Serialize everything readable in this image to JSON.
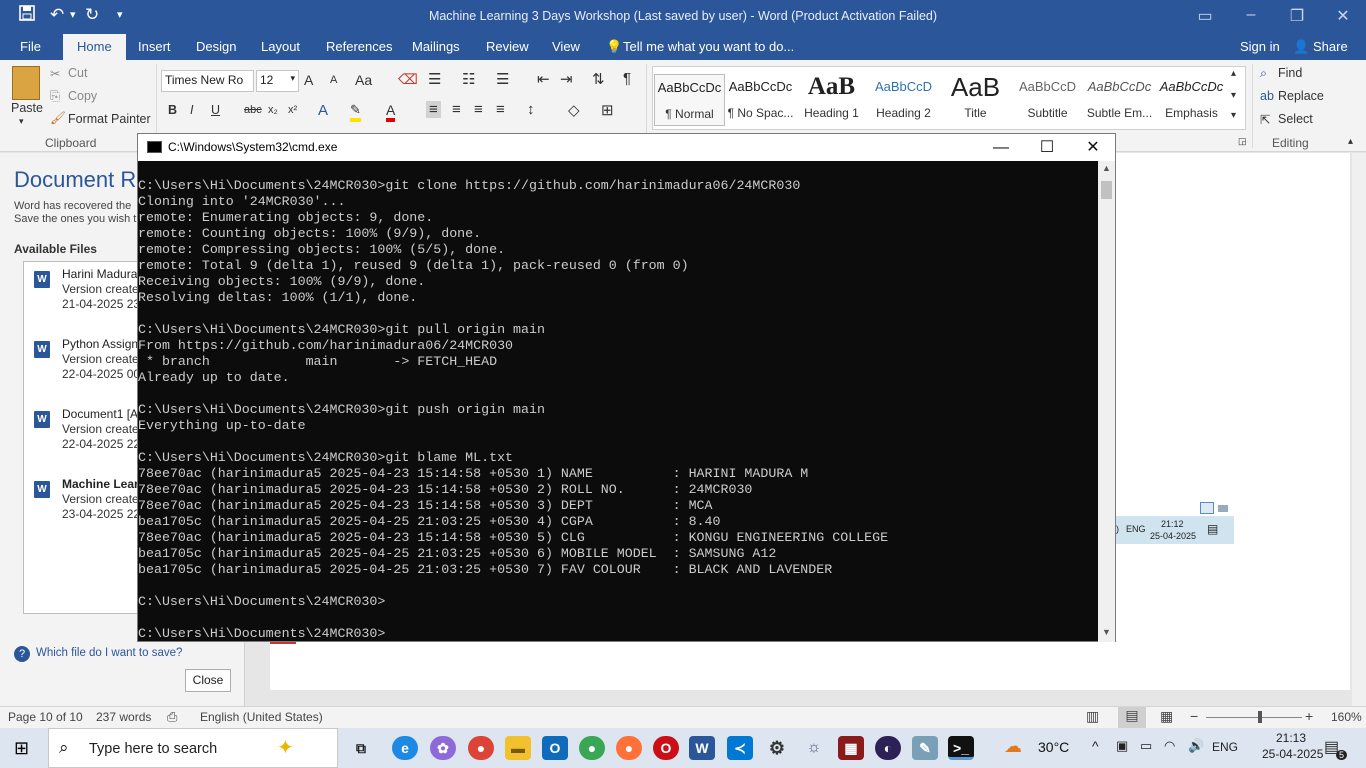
{
  "word": {
    "window_title": "Machine Learning 3 Days Workshop (Last saved by user) - Word (Product Activation Failed)",
    "tabs": [
      "File",
      "Home",
      "Insert",
      "Design",
      "Layout",
      "References",
      "Mailings",
      "Review",
      "View"
    ],
    "tell_me": "Tell me what you want to do...",
    "sign_in": "Sign in",
    "share": "Share",
    "clipboard": {
      "paste": "Paste",
      "cut": "Cut",
      "copy": "Copy",
      "format_painter": "Format Painter",
      "group": "Clipboard"
    },
    "font": {
      "name": "Times New Ro",
      "size": "12"
    },
    "styles": [
      {
        "preview": "AaBbCcDc",
        "name": "¶ Normal"
      },
      {
        "preview": "AaBbCcDc",
        "name": "¶ No Spac..."
      },
      {
        "preview": "AaB",
        "name": "Heading 1"
      },
      {
        "preview": "AaBbCcD",
        "name": "Heading 2"
      },
      {
        "preview": "AaB",
        "name": "Title"
      },
      {
        "preview": "AaBbCcD",
        "name": "Subtitle"
      },
      {
        "preview": "AaBbCcDc",
        "name": "Subtle Em..."
      },
      {
        "preview": "AaBbCcDc",
        "name": "Emphasis"
      }
    ],
    "editing": {
      "find": "Find",
      "replace": "Replace",
      "select": "Select",
      "group": "Editing"
    },
    "recovery": {
      "title": "Document Re",
      "desc1": "Word has recovered the",
      "desc2": "Save the ones you wish t",
      "available": "Available Files",
      "files": [
        {
          "name": "Harini Madura",
          "version": "Version created",
          "date": "21-04-2025 23:4"
        },
        {
          "name": "Python Assignm",
          "version": "Version created",
          "date": "22-04-2025 00:0"
        },
        {
          "name": "Document1  [A",
          "version": "Version created",
          "date": "22-04-2025 22:3"
        },
        {
          "name": "Machine Learn",
          "version": "Version created",
          "date": "23-04-2025 22:2"
        }
      ],
      "help": "Which file do I want to save?",
      "close": "Close"
    },
    "status": {
      "page": "Page 10 of 10",
      "words": "237 words",
      "language": "English (United States)",
      "zoom": "160%"
    },
    "inner_tray": {
      "lang": "ENG",
      "time": "21:12",
      "date": "25-04-2025"
    }
  },
  "cmd": {
    "title": "C:\\Windows\\System32\\cmd.exe",
    "lines": [
      "C:\\Users\\Hi\\Documents\\24MCR030>git clone https://github.com/harinimadura06/24MCR030",
      "Cloning into '24MCR030'...",
      "remote: Enumerating objects: 9, done.",
      "remote: Counting objects: 100% (9/9), done.",
      "remote: Compressing objects: 100% (5/5), done.",
      "remote: Total 9 (delta 1), reused 9 (delta 1), pack-reused 0 (from 0)",
      "Receiving objects: 100% (9/9), done.",
      "Resolving deltas: 100% (1/1), done.",
      "",
      "C:\\Users\\Hi\\Documents\\24MCR030>git pull origin main",
      "From https://github.com/harinimadura06/24MCR030",
      " * branch            main       -> FETCH_HEAD",
      "Already up to date.",
      "",
      "C:\\Users\\Hi\\Documents\\24MCR030>git push origin main",
      "Everything up-to-date",
      "",
      "C:\\Users\\Hi\\Documents\\24MCR030>git blame ML.txt",
      "78ee70ac (harinimadura5 2025-04-23 15:14:58 +0530 1) NAME          : HARINI MADURA M",
      "78ee70ac (harinimadura5 2025-04-23 15:14:58 +0530 2) ROLL NO.      : 24MCR030",
      "78ee70ac (harinimadura5 2025-04-23 15:14:58 +0530 3) DEPT          : MCA",
      "bea1705c (harinimadura5 2025-04-25 21:03:25 +0530 4) CGPA          : 8.40",
      "78ee70ac (harinimadura5 2025-04-23 15:14:58 +0530 5) CLG           : KONGU ENGINEERING COLLEGE",
      "bea1705c (harinimadura5 2025-04-25 21:03:25 +0530 6) MOBILE MODEL  : SAMSUNG A12",
      "bea1705c (harinimadura5 2025-04-25 21:03:25 +0530 7) FAV COLOUR    : BLACK AND LAVENDER",
      "",
      "C:\\Users\\Hi\\Documents\\24MCR030>",
      "",
      "C:\\Users\\Hi\\Documents\\24MCR030>"
    ]
  },
  "taskbar": {
    "search_placeholder": "Type here to search",
    "weather": "30°C",
    "lang": "ENG",
    "time": "21:13",
    "date": "25-04-2025",
    "notif_count": "5"
  },
  "colors": {
    "word_blue": "#2b579a",
    "console_bg": "#0c0c0c",
    "console_fg": "#cccccc"
  }
}
